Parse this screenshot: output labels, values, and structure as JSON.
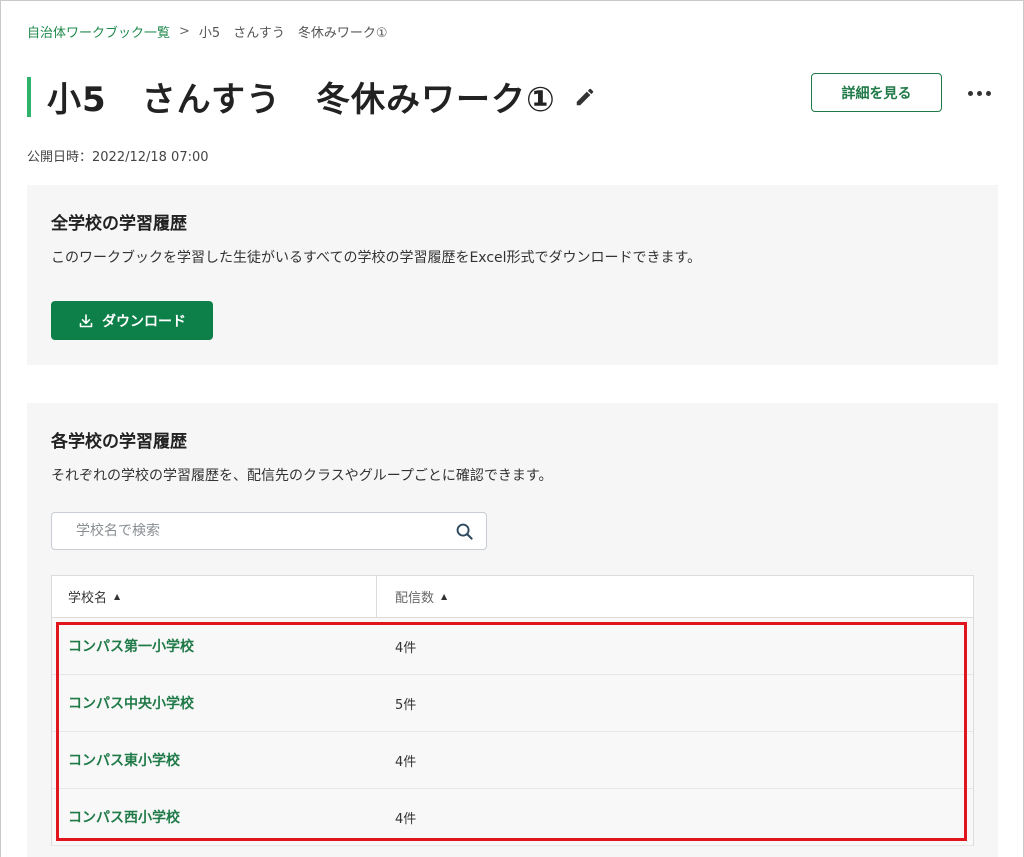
{
  "breadcrumb": {
    "parent": "自治体ワークブック一覧",
    "separator": ">",
    "current": "小5　さんすう　冬休みワーク①"
  },
  "page": {
    "title": "小5　さんすう　冬休みワーク①",
    "detail_button": "詳細を見る",
    "published": "公開日時：2022/12/18 07:00"
  },
  "all_schools": {
    "heading": "全学校の学習履歴",
    "description": "このワークブックを学習した生徒がいるすべての学校の学習履歴をExcel形式でダウンロードできます。",
    "download_label": "ダウンロード"
  },
  "each_school": {
    "heading": "各学校の学習履歴",
    "description": "それぞれの学校の学習履歴を、配信先のクラスやグループごとに確認できます。",
    "search_placeholder": "学校名で検索",
    "columns": [
      "学校名",
      "配信数"
    ],
    "rows": [
      {
        "school": "コンパス第一小学校",
        "count": "4件"
      },
      {
        "school": "コンパス中央小学校",
        "count": "5件"
      },
      {
        "school": "コンパス東小学校",
        "count": "4件"
      },
      {
        "school": "コンパス西小学校",
        "count": "4件"
      }
    ]
  },
  "colors": {
    "accent": "#1f7a48",
    "primary_button": "#0d7f48",
    "title_bar": "#2fb36b",
    "highlight": "#e0151e"
  }
}
